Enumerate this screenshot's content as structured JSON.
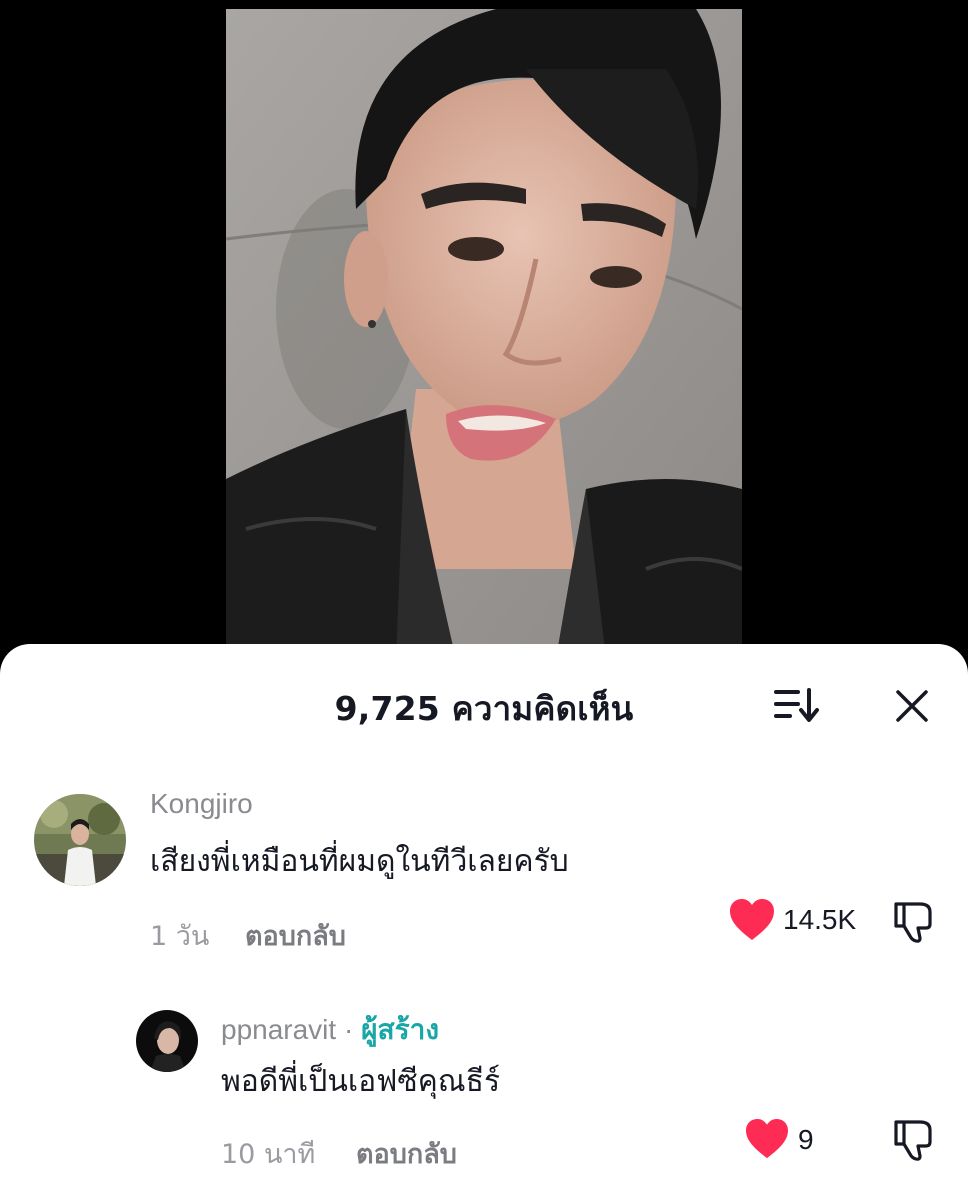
{
  "colors": {
    "like_heart": "#fe2c55",
    "creator_badge": "#1aa6a6",
    "sheet_bg": "#ffffff",
    "page_bg": "#000000"
  },
  "sheet": {
    "title": "9,725 ความคิดเห็น",
    "icons": [
      "sort-icon",
      "close-icon"
    ]
  },
  "comments": [
    {
      "username": "Kongjiro",
      "text": "เสียงพี่เหมือนที่ผมดูในทีวีเลยครับ",
      "time": "1 วัน",
      "reply_label": "ตอบกลับ",
      "likes": "14.5K"
    }
  ],
  "replies": [
    {
      "username": "ppnaravit",
      "separator": "·",
      "badge": "ผู้สร้าง",
      "text": "พอดีพี่เป็นเอฟซีคุณธีร์",
      "time": "10 นาที",
      "reply_label": "ตอบกลับ",
      "likes": "9"
    }
  ]
}
